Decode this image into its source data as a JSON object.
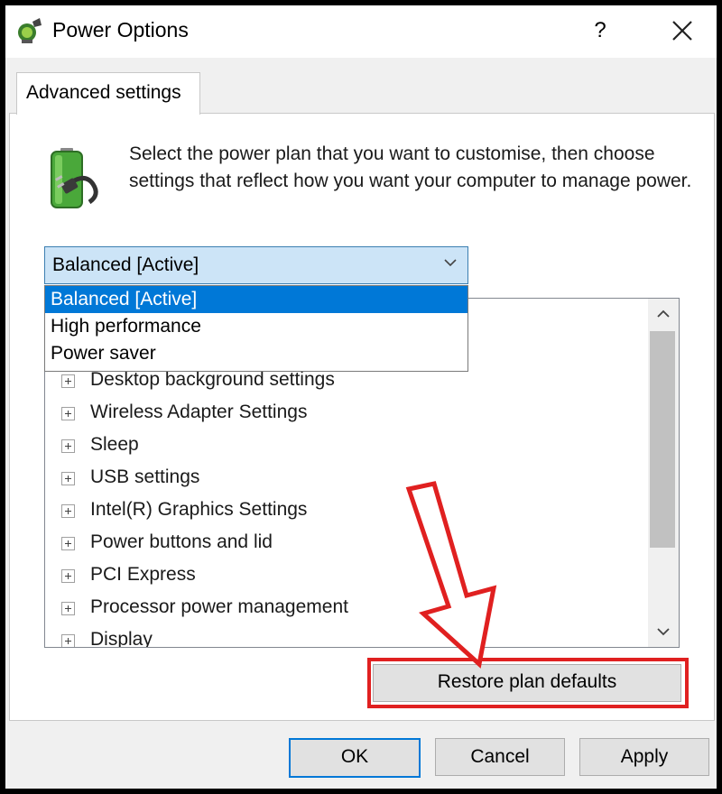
{
  "window": {
    "title": "Power Options",
    "help_label": "?",
    "icons": {
      "app": "power-options-icon",
      "close": "close-icon"
    }
  },
  "tab": {
    "label": "Advanced settings"
  },
  "description": "Select the power plan that you want to customise, then choose settings that reflect how you want your computer to manage power.",
  "plan_select": {
    "value": "Balanced [Active]",
    "options": [
      "Balanced [Active]",
      "High performance",
      "Power saver"
    ],
    "selected_index": 0
  },
  "settings_tree": {
    "items": [
      "Desktop background settings",
      "Wireless Adapter Settings",
      "Sleep",
      "USB settings",
      "Intel(R) Graphics Settings",
      "Power buttons and lid",
      "PCI Express",
      "Processor power management",
      "Display"
    ]
  },
  "buttons": {
    "restore": "Restore plan defaults",
    "ok": "OK",
    "cancel": "Cancel",
    "apply": "Apply"
  },
  "colors": {
    "accent": "#0078d7",
    "annotation_red": "#e02020",
    "select_bg": "#cce4f7"
  }
}
